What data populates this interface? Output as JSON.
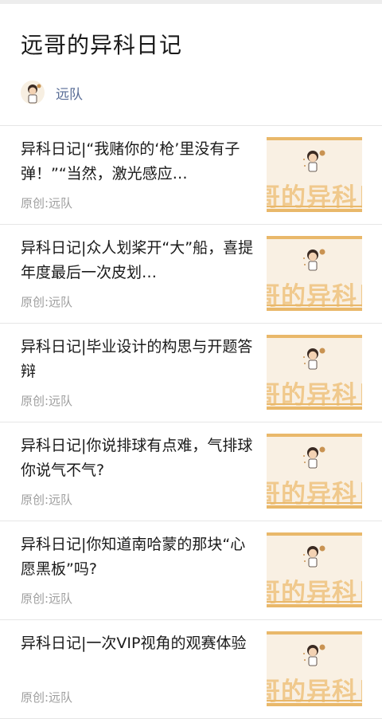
{
  "header": {
    "title": "远哥的异科日记",
    "author": "远队",
    "avatar_icon": "cartoon-boy-avatar"
  },
  "colors": {
    "author_link": "#576b95",
    "meta_text": "#9e9e9e",
    "thumb_bg": "#f9f0e3",
    "thumb_accent": "#e9b86a"
  },
  "articles": [
    {
      "title": "异科日记|“我赌你的‘枪’里没有子弹！”“当然，激光感应…",
      "source": "原创:远队",
      "thumb_text": "哥的异科日"
    },
    {
      "title": "异科日记|众人划桨开“大”船，喜提年度最后一次皮划…",
      "source": "原创:远队",
      "thumb_text": "哥的异科日"
    },
    {
      "title": "异科日记|毕业设计的构思与开题答辩",
      "source": "原创:远队",
      "thumb_text": "哥的异科日"
    },
    {
      "title": "异科日记|你说排球有点难，气排球你说气不气?",
      "source": "原创:远队",
      "thumb_text": "哥的异科日"
    },
    {
      "title": "异科日记|你知道南哈蒙的那块“心愿黑板”吗?",
      "source": "原创:远队",
      "thumb_text": "哥的异科日"
    },
    {
      "title": "异科日记|一次VIP视角的观赛体验",
      "source": "原创:远队",
      "thumb_text": "哥的异科日"
    }
  ]
}
